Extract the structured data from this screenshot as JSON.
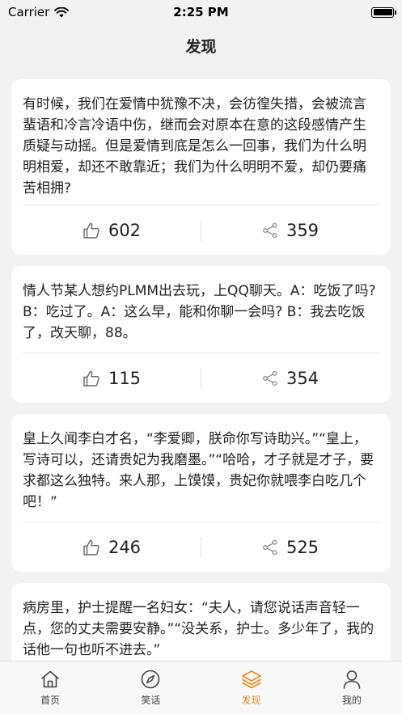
{
  "status_bar": {
    "carrier": "Carrier",
    "time": "2:25 PM"
  },
  "nav": {
    "title": "发现"
  },
  "cards": [
    {
      "text": "有时候，我们在爱情中犹豫不决，会彷徨失措，会被流言蜚语和冷言冷语中伤，继而会对原本在意的这段感情产生质疑与动摇。但是爱情到底是怎么一回事，我们为什么明明相爱，却还不敢靠近；我们为什么明明不爱，却仍要痛苦相拥?",
      "likes": "602",
      "shares": "359"
    },
    {
      "text": "情人节某人想约PLMM出去玩，上QQ聊天。A：吃饭了吗? B：吃过了。A：这么早，能和你聊一会吗? B：我去吃饭了，改天聊，88。",
      "likes": "115",
      "shares": "354"
    },
    {
      "text": "皇上久闻李白才名，“李爱卿，朕命你写诗助兴。”“皇上，写诗可以，还请贵妃为我磨墨。”“哈哈，才子就是才子，要求都这么独特。来人那，上馍馍，贵妃你就喂李白吃几个吧！”",
      "likes": "246",
      "shares": "525"
    },
    {
      "text": "病房里，护士提醒一名妇女：“夫人，请您说话声音轻一点，您的丈夫需要安静。”“没关系，护士。多少年了，我的话他一句也听不进去。”",
      "likes": "",
      "shares": ""
    }
  ],
  "tabs": [
    {
      "label": "首页",
      "icon": "home-icon",
      "active": false
    },
    {
      "label": "笑话",
      "icon": "compass-icon",
      "active": false
    },
    {
      "label": "发现",
      "icon": "layers-icon",
      "active": true
    },
    {
      "label": "我的",
      "icon": "person-icon",
      "active": false
    }
  ],
  "colors": {
    "accent": "#e08a1e",
    "background": "#f2f2f2",
    "card": "#ffffff",
    "text": "#222222"
  }
}
